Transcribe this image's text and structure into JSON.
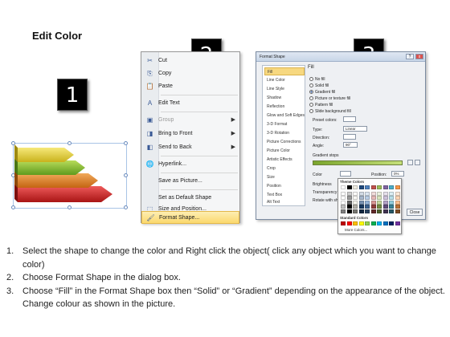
{
  "title": "Edit Color",
  "badges": [
    "1",
    "2",
    "3"
  ],
  "context_menu": {
    "items": [
      {
        "label": "Cut",
        "icon": "scissors-icon",
        "glyph": "✂"
      },
      {
        "label": "Copy",
        "icon": "copy-icon",
        "glyph": "⎘"
      },
      {
        "label": "Paste",
        "icon": "paste-icon",
        "glyph": "📋"
      },
      {
        "label": "Edit Text",
        "icon": "edit-text-icon",
        "glyph": "A"
      },
      {
        "label": "Group",
        "icon": "group-icon",
        "glyph": "▣"
      },
      {
        "label": "Bring to Front",
        "icon": "bring-to-front-icon",
        "glyph": "◨"
      },
      {
        "label": "Send to Back",
        "icon": "send-to-back-icon",
        "glyph": "◧"
      },
      {
        "label": "Hyperlink...",
        "icon": "hyperlink-icon",
        "glyph": "🌐"
      },
      {
        "label": "Save as Picture...",
        "icon": "",
        "glyph": ""
      },
      {
        "label": "Set as Default Shape",
        "icon": "",
        "glyph": ""
      },
      {
        "label": "Size and Position...",
        "icon": "size-position-icon",
        "glyph": "⬚"
      },
      {
        "label": "Format Shape...",
        "icon": "format-shape-icon",
        "glyph": "🖌"
      }
    ]
  },
  "dialog": {
    "title": "Format Shape",
    "controls": [
      "?",
      "x"
    ],
    "categories": [
      "Fill",
      "Line Color",
      "Line Style",
      "Shadow",
      "Reflection",
      "Glow and Soft Edges",
      "3-D Format",
      "3-D Rotation",
      "Picture Corrections",
      "Picture Color",
      "Artistic Effects",
      "Crop",
      "Size",
      "Position",
      "Text Box",
      "Alt Text"
    ],
    "active_category": "Fill",
    "fill_heading": "Fill",
    "fill_options": [
      "No fill",
      "Solid fill",
      "Gradient fill",
      "Picture or texture fill",
      "Pattern fill",
      "Slide background fill"
    ],
    "selected_fill": "Gradient fill",
    "preset_label": "Preset colors:",
    "type_label": "Type:",
    "type_value": "Linear",
    "direction_label": "Direction:",
    "angle_label": "Angle:",
    "angle_value": "90°",
    "stops_label": "Gradient stops",
    "color_label": "Color",
    "position_label": "Position:",
    "position_value": "0%",
    "brightness_label": "Brightness",
    "transparency_label": "Transparency",
    "rotate_label": "Rotate with shape",
    "close_label": "Close"
  },
  "palette": {
    "theme_heading": "Theme Colors",
    "standard_heading": "Standard Colors",
    "more_label": "More Colors...",
    "theme_top": [
      "#ffffff",
      "#000000",
      "#eeece1",
      "#1f497d",
      "#4f81bd",
      "#c0504d",
      "#9bbb59",
      "#8064a2",
      "#4bacc6",
      "#f79646"
    ],
    "standard": [
      "#c00000",
      "#ff0000",
      "#ffc000",
      "#ffff00",
      "#92d050",
      "#00b050",
      "#00b0f0",
      "#0070c0",
      "#002060",
      "#7030a0"
    ]
  },
  "instructions": [
    {
      "num": "1.",
      "text": "Select the shape to change the color and Right click the object( click any object which you want to change color)"
    },
    {
      "num": "2.",
      "text": "Choose Format Shape in the dialog box."
    },
    {
      "num": "3.",
      "text": "Choose “Fill” in the Format Shape box then “Solid” or “Gradient” depending on the appearance of the object. Change colour as shown in the picture."
    }
  ]
}
